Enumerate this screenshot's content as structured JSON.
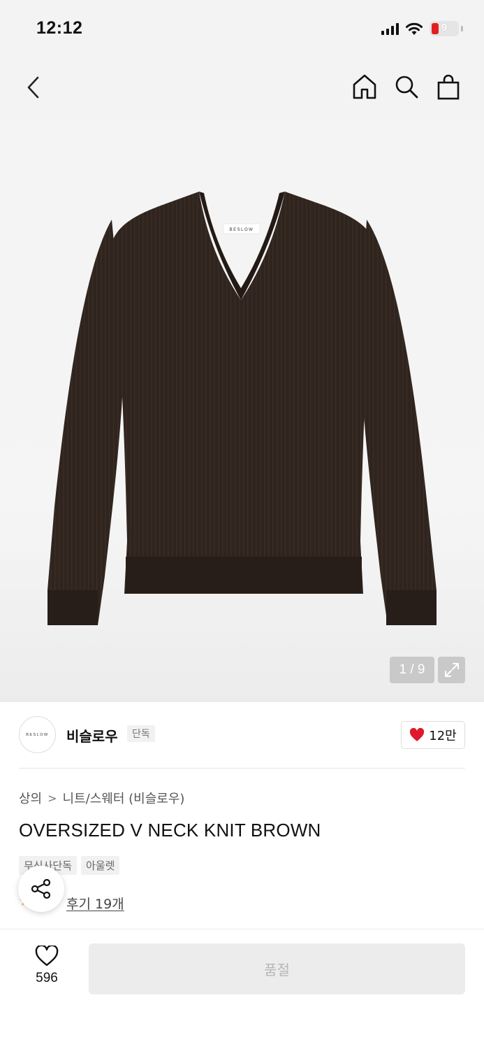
{
  "status_bar": {
    "time": "12:12",
    "battery": "9"
  },
  "product_image": {
    "counter": "1 / 9",
    "label_text": "BESLOW"
  },
  "brand": {
    "logo_text": "BESLOW",
    "name": "비슬로우",
    "badge": "단독",
    "likes": "12만"
  },
  "breadcrumb": {
    "category": "상의",
    "subcategory": "니트/스웨터 (비슬로우)"
  },
  "product": {
    "title": "OVERSIZED V NECK KNIT BROWN"
  },
  "tags": [
    "무신사단독",
    "아울렛"
  ],
  "review": {
    "rating": "5",
    "link": "후기 19개"
  },
  "bottom_bar": {
    "wish_count": "596",
    "buy_label": "품절"
  },
  "colors": {
    "sweater": "#2f241e",
    "heart": "#e0182d",
    "star": "#f5a623",
    "soldout_bg": "#ececec"
  }
}
